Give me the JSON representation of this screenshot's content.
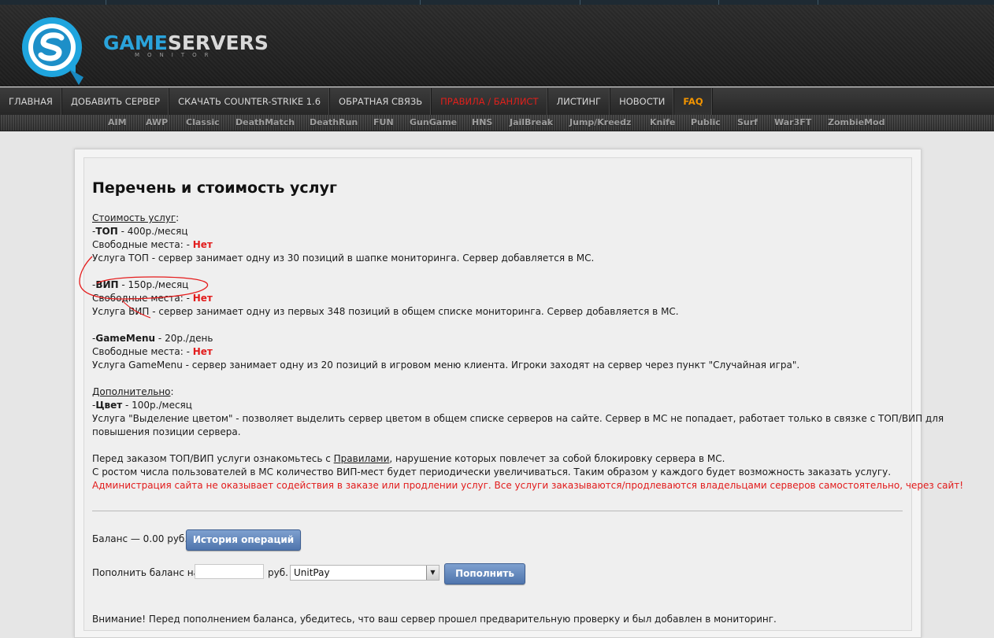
{
  "brand": {
    "part1": "GAME",
    "part2": "SERVERS",
    "subtitle": "MONITOR"
  },
  "nav": {
    "items": [
      {
        "label": "ГЛАВНАЯ"
      },
      {
        "label": "ДОБАВИТЬ СЕРВЕР"
      },
      {
        "label": "СКАЧАТЬ COUNTER-STRIKE 1.6"
      },
      {
        "label": "ОБРАТНАЯ СВЯЗЬ"
      },
      {
        "label": "ПРАВИЛА / БАНЛИСТ"
      },
      {
        "label": "ЛИСТИНГ"
      },
      {
        "label": "НОВОСТИ"
      },
      {
        "label": "FAQ"
      }
    ],
    "rules_color": "#e0201b",
    "faq_color": "#f29400"
  },
  "subnav": {
    "items": [
      {
        "label": "AIM"
      },
      {
        "label": "AWP"
      },
      {
        "label": "Classic"
      },
      {
        "label": "DeathMatch"
      },
      {
        "label": "DeathRun"
      },
      {
        "label": "FUN"
      },
      {
        "label": "GunGame"
      },
      {
        "label": "HNS"
      },
      {
        "label": "JailBreak"
      },
      {
        "label": "Jump/Kreedz"
      },
      {
        "label": "Knife"
      },
      {
        "label": "Public"
      },
      {
        "label": "Surf"
      },
      {
        "label": "War3FT"
      },
      {
        "label": "ZombieMod"
      }
    ]
  },
  "content": {
    "title": "Перечень и стоимость услуг",
    "cost_heading": "Стоимость услуг",
    "colon": ":",
    "dash": "-",
    "free_label": "Свободные места: - ",
    "no": "Нет",
    "top": {
      "name": "ТОП",
      "price": " - 400р./месяц",
      "desc": "Услуга ТОП - сервер занимает одну из 30 позиций в шапке мониторинга. Сервер добавляется в МС."
    },
    "vip": {
      "name": "ВИП",
      "price": " - 150р./месяц",
      "desc": "Услуга ВИП - сервер занимает одну из первых 348 позиций в общем списке мониторинга. Сервер добавляется в МС."
    },
    "gamemenu": {
      "name": "GameMenu",
      "price": " - 20р./день",
      "desc": "Услуга GameMenu - сервер занимает одну из 20 позиций в игровом меню клиента. Игроки заходят на сервер через пункт \"Случайная игра\"."
    },
    "extra_heading": "Дополнительно",
    "color": {
      "name": "Цвет",
      "price": " - 100р./месяц",
      "desc1": "Услуга \"Выделение цветом\" - позволяет выделить сервер цветом в общем списке серверов на сайте. Сервер в МС не попадает, работает только в связке с ТОП/ВИП для",
      "desc2": "повышения позиции сервера."
    },
    "notice1_before": "Перед заказом ТОП/ВИП услуги ознакомьтесь с ",
    "notice1_link": "Правилами",
    "notice1_after": ", нарушение которых повлечет за собой блокировку сервера в МС.",
    "notice2": "С ростом числа пользователей в МС количество ВИП-мест будет периодически увеличиваться. Таким образом у каждого будет возможность заказать услугу.",
    "notice3": "Администрация сайта не оказывает содействия в заказе или продлении услуг. Все услуги заказываются/продлеваются владельцами серверов самостоятельно, через сайт!",
    "alert_color": "#e21b1b"
  },
  "balance": {
    "label": "Баланс — 0.00 руб.",
    "history_button": "История операций",
    "topup_label": "Пополнить баланс на",
    "amount_value": "",
    "currency": "руб.",
    "method_selected": "UnitPay",
    "topup_button": "Пополнить"
  },
  "footer_note": "Внимание! Перед пополнением баланса, убедитесь, что ваш сервер прошел предварительную проверку и был добавлен в мониторинг."
}
